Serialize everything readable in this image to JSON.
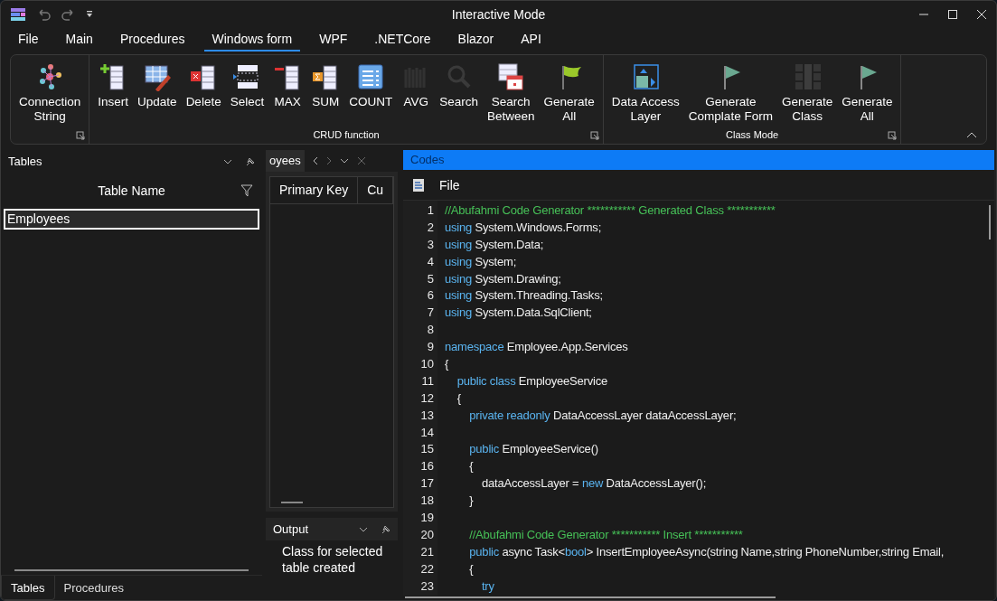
{
  "window": {
    "title": "Interactive Mode"
  },
  "menu_tabs": [
    {
      "label": "File",
      "selected": false
    },
    {
      "label": "Main",
      "selected": false
    },
    {
      "label": "Procedures",
      "selected": false
    },
    {
      "label": "Windows form",
      "selected": true
    },
    {
      "label": "WPF",
      "selected": false
    },
    {
      "label": ".NETCore",
      "selected": false
    },
    {
      "label": "Blazor",
      "selected": false
    },
    {
      "label": "API",
      "selected": false
    }
  ],
  "ribbon": {
    "groups": [
      {
        "buttons": [
          {
            "label": "Connection String",
            "disabled": false
          }
        ]
      },
      {
        "label": "CRUD function",
        "buttons": [
          {
            "label": "Insert",
            "disabled": false
          },
          {
            "label": "Update",
            "disabled": false
          },
          {
            "label": "Delete",
            "disabled": false
          },
          {
            "label": "Select",
            "disabled": false
          },
          {
            "label": "MAX",
            "disabled": false
          },
          {
            "label": "SUM",
            "disabled": false
          },
          {
            "label": "COUNT",
            "disabled": false
          },
          {
            "label": "AVG",
            "disabled": true
          },
          {
            "label": "Search",
            "disabled": true
          },
          {
            "label": "Search Between",
            "disabled": false
          },
          {
            "label": "Generate All",
            "disabled": false
          }
        ]
      },
      {
        "label": "Class Mode",
        "buttons": [
          {
            "label": "Data Access Layer",
            "disabled": false
          },
          {
            "label": "Generate Complate Form",
            "disabled": false
          },
          {
            "label": "Generate Class",
            "disabled": true
          },
          {
            "label": "Generate All",
            "disabled": false
          }
        ]
      }
    ]
  },
  "tables_panel": {
    "title": "Tables",
    "column": "Table Name",
    "rows": [
      {
        "label": "Employees",
        "selected": true
      }
    ],
    "tabs": [
      {
        "label": "Tables",
        "selected": true
      },
      {
        "label": "Procedures",
        "selected": false
      }
    ]
  },
  "document_panel": {
    "tab": "oyees",
    "columns": [
      "Primary Key",
      "Cu"
    ]
  },
  "output_panel": {
    "title": "Output",
    "message": "Class for selected table created"
  },
  "code_panel": {
    "title": "Codes",
    "toolbar_label": "File",
    "lines": [
      {
        "number": "1",
        "segments": [
          {
            "kind": "comment",
            "text": "//Abufahmi Code Generator *********** Generated Class ***********"
          }
        ]
      },
      {
        "number": "2",
        "segments": [
          {
            "kind": "keyword",
            "text": "using"
          },
          {
            "kind": "plain",
            "text": " System.Windows.Forms;"
          }
        ]
      },
      {
        "number": "3",
        "segments": [
          {
            "kind": "keyword",
            "text": "using"
          },
          {
            "kind": "plain",
            "text": " System.Data;"
          }
        ]
      },
      {
        "number": "4",
        "segments": [
          {
            "kind": "keyword",
            "text": "using"
          },
          {
            "kind": "plain",
            "text": " System;"
          }
        ]
      },
      {
        "number": "5",
        "segments": [
          {
            "kind": "keyword",
            "text": "using"
          },
          {
            "kind": "plain",
            "text": " System.Drawing;"
          }
        ]
      },
      {
        "number": "6",
        "segments": [
          {
            "kind": "keyword",
            "text": "using"
          },
          {
            "kind": "plain",
            "text": " System.Threading.Tasks;"
          }
        ]
      },
      {
        "number": "7",
        "segments": [
          {
            "kind": "keyword",
            "text": "using"
          },
          {
            "kind": "plain",
            "text": " System.Data.SqlClient;"
          }
        ]
      },
      {
        "number": "8"
      },
      {
        "number": "9",
        "segments": [
          {
            "kind": "keyword",
            "text": "namespace"
          },
          {
            "kind": "plain",
            "text": " Employee.App.Services"
          }
        ]
      },
      {
        "number": "10",
        "segments": [
          {
            "kind": "plain",
            "text": "{"
          }
        ]
      },
      {
        "number": "11",
        "segments": [
          {
            "kind": "keyword",
            "text": "    public class"
          },
          {
            "kind": "plain",
            "text": " EmployeeService"
          }
        ]
      },
      {
        "number": "12",
        "segments": [
          {
            "kind": "plain",
            "text": "    {"
          }
        ]
      },
      {
        "number": "13",
        "segments": [
          {
            "kind": "keyword",
            "text": "        private readonly"
          },
          {
            "kind": "plain",
            "text": " DataAccessLayer dataAccessLayer;"
          }
        ]
      },
      {
        "number": "14"
      },
      {
        "number": "15",
        "segments": [
          {
            "kind": "keyword",
            "text": "        public"
          },
          {
            "kind": "plain",
            "text": " EmployeeService()"
          }
        ]
      },
      {
        "number": "16",
        "segments": [
          {
            "kind": "plain",
            "text": "        {"
          }
        ]
      },
      {
        "number": "17",
        "segments": [
          {
            "kind": "plain",
            "text": "            dataAccessLayer = "
          },
          {
            "kind": "keyword",
            "text": "new"
          },
          {
            "kind": "plain",
            "text": " DataAccessLayer();"
          }
        ]
      },
      {
        "number": "18",
        "segments": [
          {
            "kind": "plain",
            "text": "        }"
          }
        ]
      },
      {
        "number": "19"
      },
      {
        "number": "20",
        "segments": [
          {
            "kind": "comment",
            "text": "        //Abufahmi Code Generator *********** Insert ***********"
          }
        ]
      },
      {
        "number": "21",
        "segments": [
          {
            "kind": "keyword",
            "text": "        public"
          },
          {
            "kind": "plain",
            "text": " async Task<"
          },
          {
            "kind": "keyword",
            "text": "bool"
          },
          {
            "kind": "plain",
            "text": "> InsertEmployeeAsync(string Name,string PhoneNumber,string Email,"
          }
        ]
      },
      {
        "number": "22",
        "segments": [
          {
            "kind": "plain",
            "text": "        {"
          }
        ]
      },
      {
        "number": "23",
        "segments": [
          {
            "kind": "keyword",
            "text": "            try"
          }
        ]
      }
    ]
  }
}
